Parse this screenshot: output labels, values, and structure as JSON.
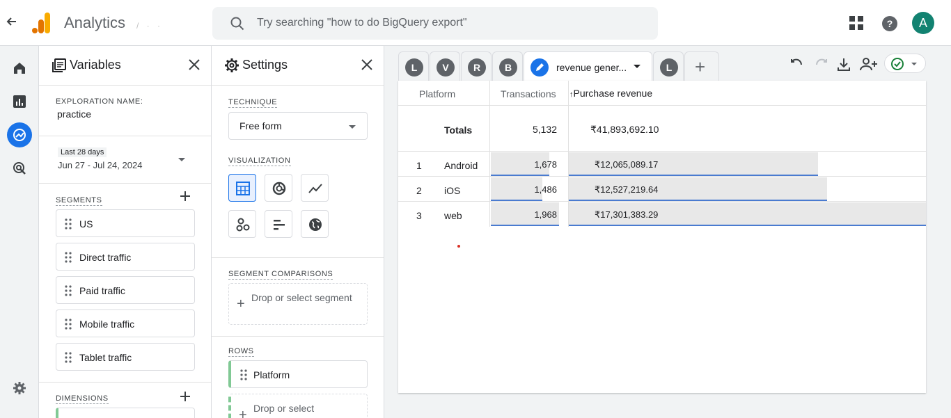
{
  "app": {
    "title": "Analytics",
    "account_obscured": "/ · ·",
    "search_placeholder": "Try searching \"how to do BigQuery export\"",
    "avatar_letter": "A"
  },
  "colors": {
    "accent": "#1a73e8",
    "avatar": "#128271",
    "row_chip_border": "#81c995",
    "logo_orange": "#f9ab00",
    "logo_dark_orange": "#e37400"
  },
  "left_nav": [
    "home-icon",
    "reports-icon",
    "explore-icon",
    "advertising-icon",
    "settings-icon"
  ],
  "variables": {
    "title": "Variables",
    "exploration_name_label": "EXPLORATION NAME:",
    "exploration_name": "practice",
    "date_badge": "Last 28 days",
    "date_range": "Jun 27 - Jul 24, 2024",
    "segments_label": "SEGMENTS",
    "segments": [
      "US",
      "Direct traffic",
      "Paid traffic",
      "Mobile traffic",
      "Tablet traffic"
    ],
    "dimensions_label": "DIMENSIONS"
  },
  "settings": {
    "title": "Settings",
    "technique_label": "TECHNIQUE",
    "technique_value": "Free form",
    "visualization_label": "VISUALIZATION",
    "segment_comparisons_label": "SEGMENT COMPARISONS",
    "drop_segment": "Drop or select segment",
    "rows_label": "ROWS",
    "row_chip": "Platform",
    "drop_rows": "Drop or select"
  },
  "tabs": {
    "letters": [
      "L",
      "V",
      "R",
      "B"
    ],
    "active_label": "revenue gener...",
    "last_letter": "L",
    "add": "+"
  },
  "table": {
    "headers": [
      "Platform",
      "Transactions",
      "Purchase revenue"
    ],
    "sort_indicator": "↑",
    "totals_label": "Totals",
    "totals_transactions": "5,132",
    "totals_revenue": "₹41,893,692.10",
    "rows": [
      {
        "index": "1",
        "platform": "Android",
        "transactions": "1,678",
        "revenue": "₹12,065,089.17",
        "tx_fraction": 0.853,
        "rev_fraction": 0.697
      },
      {
        "index": "2",
        "platform": "iOS",
        "transactions": "1,486",
        "revenue": "₹12,527,219.64",
        "tx_fraction": 0.755,
        "rev_fraction": 0.724
      },
      {
        "index": "3",
        "platform": "web",
        "transactions": "1,968",
        "revenue": "₹17,301,383.29",
        "tx_fraction": 1.0,
        "rev_fraction": 1.0
      }
    ]
  }
}
